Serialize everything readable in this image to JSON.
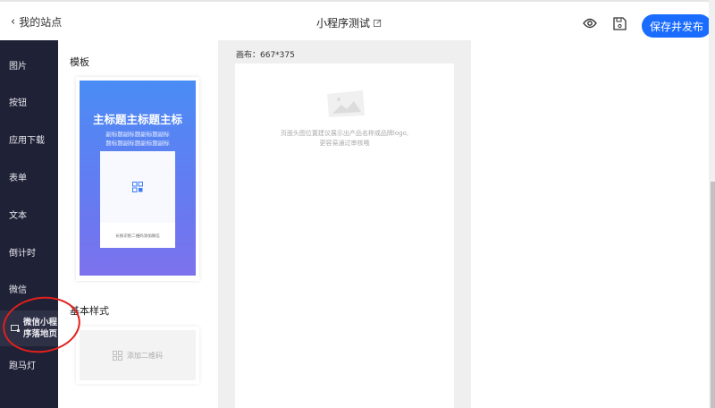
{
  "header": {
    "back_label": "我的站点",
    "title": "小程序测试",
    "publish_label": "保存并发布",
    "accent": "#1a6cff"
  },
  "sidebar": {
    "items": [
      {
        "label": "图片"
      },
      {
        "label": "按钮"
      },
      {
        "label": "应用下载"
      },
      {
        "label": "表单"
      },
      {
        "label": "文本"
      },
      {
        "label": "倒计时"
      },
      {
        "label": "微信"
      },
      {
        "label": "微信小程序落地页",
        "line1": "微信小程",
        "line2": "序落地页",
        "active": true
      },
      {
        "label": "跑马灯"
      }
    ]
  },
  "panel": {
    "templates_title": "模板",
    "template": {
      "main_title": "主标题主标题主标",
      "sub_line1": "副标题副标题副标题副标",
      "sub_line2": "题标题副标题副标题副标",
      "caption": "长按识别二维码添加微信"
    },
    "basic_title": "基本样式",
    "add_qr_label": "添加二维码"
  },
  "canvas": {
    "label": "画布：667*375",
    "hint_line1": "页面头图位置建议展示出产品名称或品牌logo,",
    "hint_line2": "更容易通过审核哦"
  }
}
